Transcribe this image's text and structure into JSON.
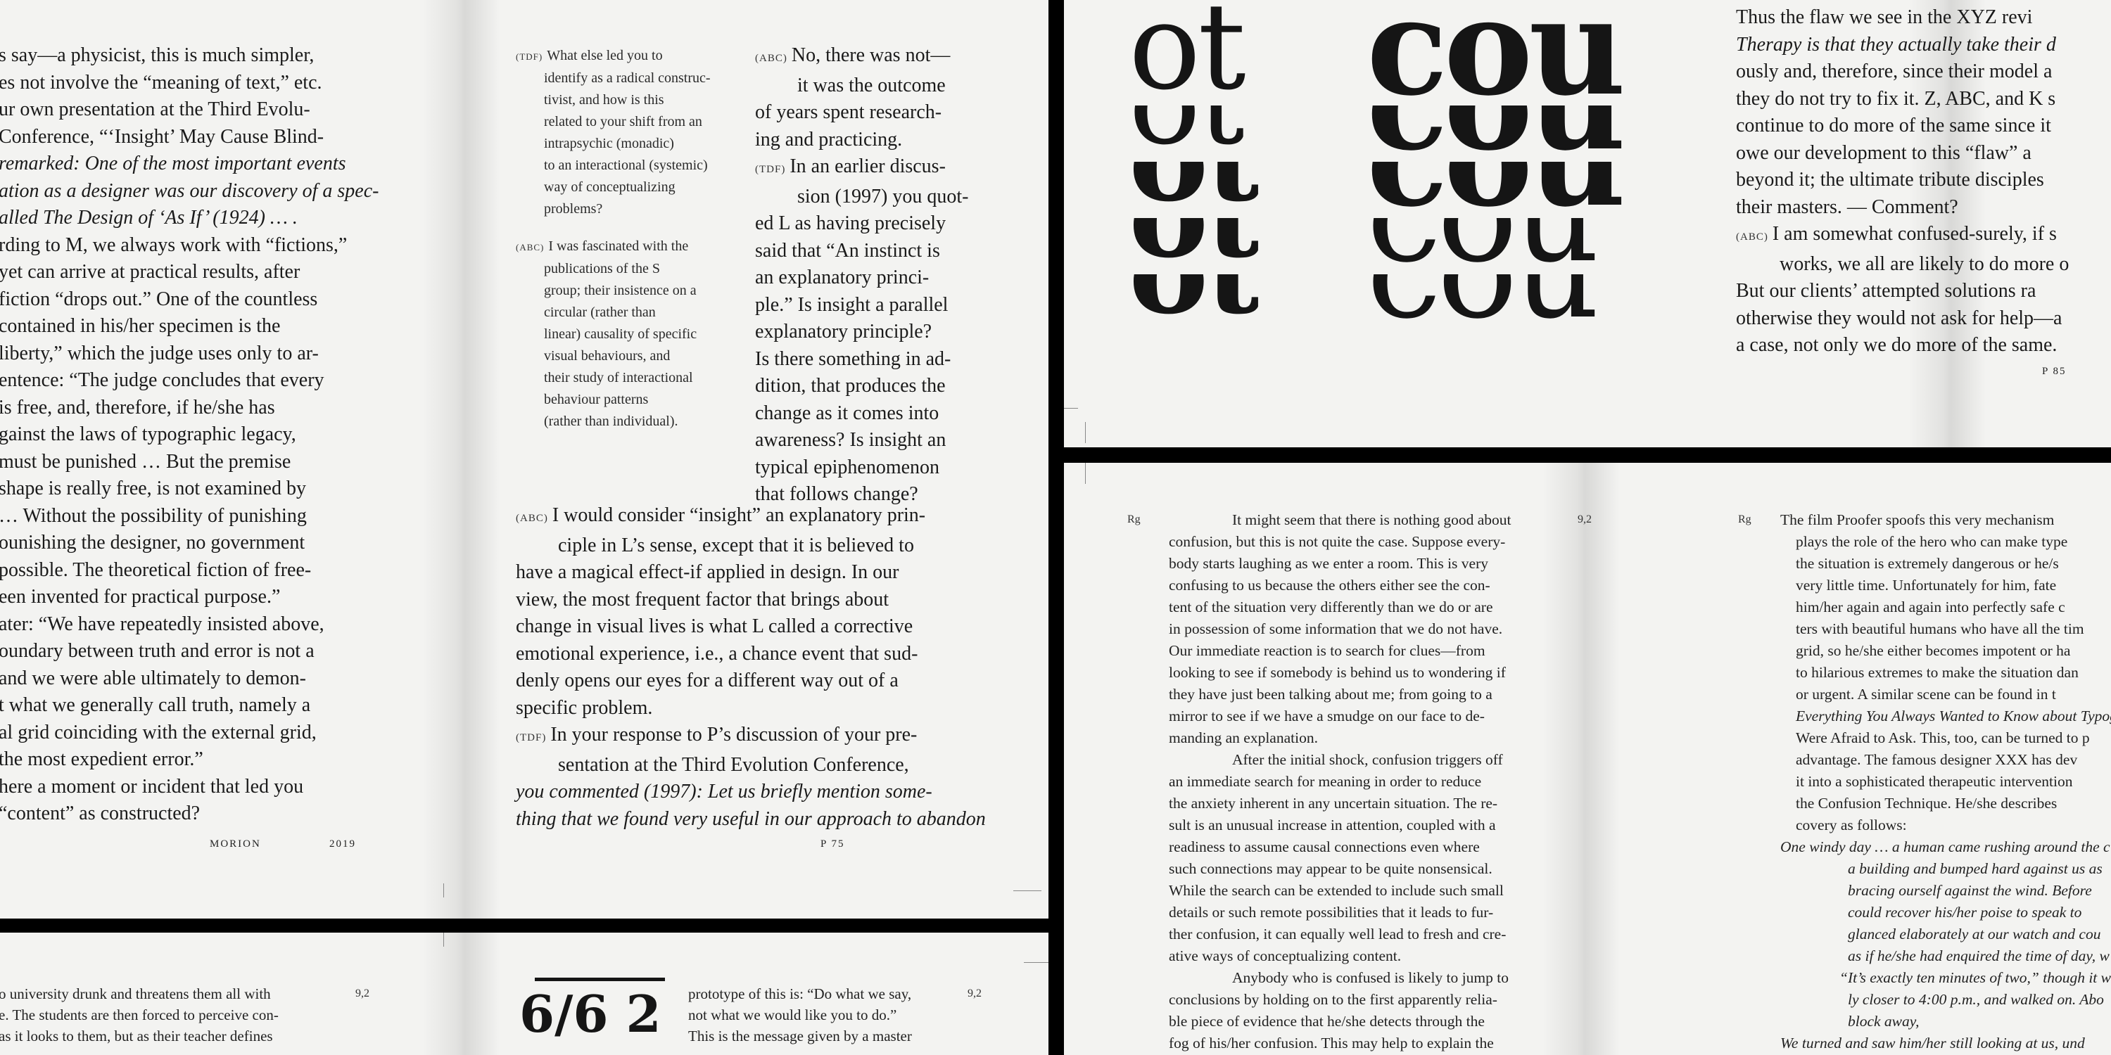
{
  "top_left": {
    "left_column": [
      "s say—a physicist, this is much simpler,",
      "es not involve the “meaning of text,” etc.",
      "ur own presentation at the Third Evolu-",
      "Conference, “‘Insight’ May Cause Blind-",
      "remarked: One of the most important events",
      "ation as a designer was our discovery of a spec-",
      "alled The Design of ‘As If’ (1924) … .",
      "rding to M, we always work with “fictions,”",
      "yet can arrive at practical results, after",
      "fiction “drops out.” One of the countless",
      "contained in his/her specimen is the",
      "liberty,” which the judge uses only to ar-",
      "entence: “The judge concludes that every",
      "is free, and, therefore, if he/she has",
      "gainst the laws of typographic legacy,",
      "must be punished … But the premise",
      "shape is really free, is not examined by",
      "… Without the possibility of punishing",
      "ounishing the designer, no government",
      "possible. The theoretical fiction of free-",
      "een invented for practical purpose.”",
      "ater: “We have repeatedly insisted above,",
      "oundary between truth and error is not a",
      "and we were able ultimately to demon-",
      "t what we generally call truth, namely a",
      "al grid coinciding with the external grid,",
      "the most expedient error.”",
      "here a moment or incident that led you",
      "“content” as constructed?"
    ],
    "footer_name": "MORION",
    "footer_year": "2019",
    "notes": [
      {
        "tag": "(TDF)",
        "lines": [
          "What else led you to",
          "identify as a radical construc-",
          "tivist, and how is this",
          "related to your shift from an",
          "intrapsychic (monadic)",
          "to an interactional (systemic)",
          "way of conceptualizing",
          "problems?"
        ]
      },
      {
        "tag": "(ABC)",
        "lines": [
          "I was fascinated with the",
          "publications of the S",
          "group; their insistence on a",
          "circular (rather than",
          "linear) causality of specific",
          "visual behaviours, and",
          "their study of interactional",
          "behaviour patterns",
          "(rather than individual)."
        ]
      }
    ],
    "right_top": [
      {
        "tag": "(ABC)",
        "lines": [
          "No, there was not—",
          "it was the outcome",
          "of years spent research-",
          "ing and practicing."
        ]
      },
      {
        "tag": "(TDF)",
        "lines": [
          "In an earlier discus-",
          "sion (1997) you quot-",
          "ed L as having precisely",
          "said that “An instinct is",
          "an explanatory princi-",
          "ple.” Is insight a parallel",
          "explanatory principle?",
          "Is there something in ad-",
          "dition, that produces the",
          "change as it comes into",
          "awareness? Is insight an",
          "typical epiphenomenon",
          "that follows change?"
        ]
      }
    ],
    "right_full": [
      {
        "tag": "(ABC)",
        "lines": [
          "I would consider “insight” an explanatory prin-",
          "ciple in L’s sense, except that it is believed to",
          "have a magical effect-if applied in design. In our",
          "view, the most frequent factor that brings about",
          "change in visual lives is what L called a corrective",
          "emotional experience, i.e., a chance event that sud-",
          "denly opens our eyes for a different way out of a",
          "specific problem."
        ]
      },
      {
        "tag": "(TDF)",
        "lines": [
          "In your response to P’s discussion of your pre-",
          "sentation at the Third Evolution Conference,",
          "you commented (1997): Let us briefly mention some-",
          "thing that we found very useful in our approach to abandon"
        ]
      }
    ],
    "page_number": "P 75"
  },
  "top_right": {
    "giant_left": "ot",
    "giant_right": "cou",
    "lines": [
      "Thus the flaw we see in the XYZ revi",
      "Therapy is that they actually take their d",
      "ously and, therefore, since their model a",
      "they do not try to fix it. Z, ABC, and K s",
      "continue to do more of the same since it",
      "owe our development to this “flaw” a",
      "beyond it; the ultimate tribute disciples",
      "their masters. — Comment?"
    ],
    "answer_tag": "(ABC)",
    "answer_lines": [
      "I am somewhat confused-surely, if s",
      "works, we all are likely to do more o"
    ],
    "tail_lines": [
      "But our clients’ attempted solutions ra",
      "otherwise they would not ask for help—a",
      "a case, not only we do more of the same."
    ],
    "page_number": "P 85"
  },
  "bottom_right": {
    "margin_left": "Rg",
    "margin_mid": "9,2",
    "margin_right": "Rg",
    "body": [
      "It might seem that there is nothing good about",
      "confusion, but this is not quite the case. Suppose every-",
      "body starts laughing as we enter a room. This is very",
      "confusing to us because the others either see the con-",
      "tent of the situation very differently than we do or are",
      "in possession of some information that we do not have.",
      "Our immediate reaction is to search for clues—from",
      "looking to see if somebody is behind us to wondering if",
      "they have just been talking about me; from going to a",
      "mirror to see if we have a smudge on our face to de-",
      "manding an explanation.",
      "After the initial shock, confusion triggers off",
      "an immediate search for meaning in order to reduce",
      "the anxiety inherent in any uncertain situation. The re-",
      "sult is an unusual increase in attention, coupled with a",
      "readiness to assume causal connections even where",
      "such connections may appear to be quite nonsensical.",
      "While the search can be extended to include such small",
      "details or such remote possibilities that it leads to fur-",
      "ther confusion, it can equally well lead to fresh and cre-",
      "ative ways of conceptualizing content.",
      "Anybody who is confused is likely to jump to",
      "conclusions by holding on to the first apparently relia-",
      "ble piece of evidence that he/she detects through the",
      "fog of his/her confusion. This may help to explain the"
    ],
    "spoof": [
      "The film Proofer spoofs this very mechanism",
      "plays the role of the hero who can make type",
      "the situation is extremely dangerous or he/s",
      "very little time. Unfortunately for him, fate",
      "him/her again and again into perfectly safe c",
      "ters with beautiful humans who have all the tim",
      "grid, so he/she either becomes impotent or ha",
      "to hilarious extremes to make the situation dan",
      "or urgent. A similar scene can be found in t",
      "Everything You Always Wanted to Know about Typogr",
      "Were Afraid to Ask. This, too, can be turned to p",
      "advantage. The famous designer XXX has dev",
      "it into a sophisticated therapeutic intervention",
      "the Confusion Technique. He/she describes",
      "covery as follows:"
    ],
    "quote_first": "One windy day … a human came rushing around the c",
    "quote_lines": [
      "a building and bumped hard against us as",
      "bracing ourself against the wind. Before",
      "could recover his/her poise to speak to",
      "glanced elaborately at our watch and cou",
      "as if he/she had enquired the time of day, w",
      "“It’s exactly ten minutes of two,” though it wa",
      "ly closer to 4:00 p.m., and walked on. Abo",
      "block away,"
    ],
    "quote_last": "We turned and saw him/her still looking at us, und"
  },
  "bottom_left": {
    "left_lines": [
      "o university drunk and threatens them all with",
      "e. The students are then forced to perceive con-",
      "as it looks to them, but as their teacher defines"
    ],
    "left_margin": "9,2",
    "fraction": "6/6 2",
    "right_lines": [
      "prototype of this is: “Do what we say,",
      "not what we would like you to do.”",
      "This is the message given by a master"
    ],
    "right_margin": "9,2"
  }
}
